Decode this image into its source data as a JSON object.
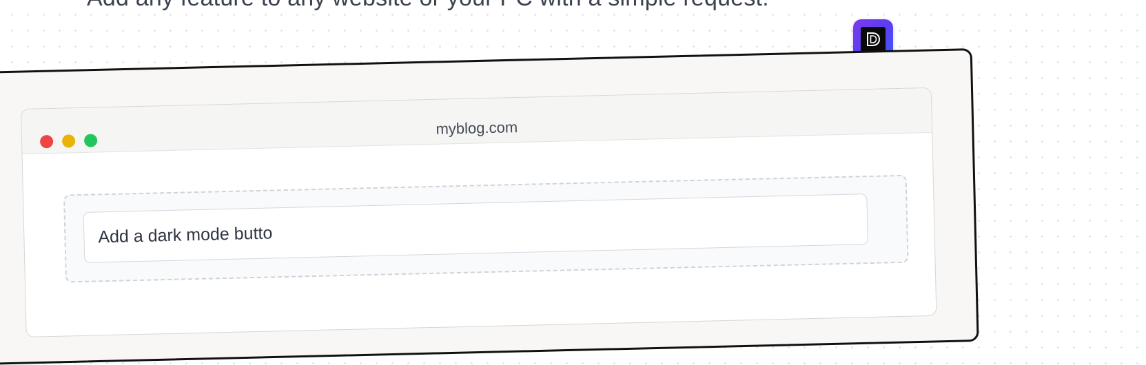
{
  "hero": {
    "headline": "Add any feature to any website or your PC with a simple request."
  },
  "app_icon": {
    "name": "app-logo-icon",
    "gradient": [
      "#7c3aed",
      "#3b5bf5"
    ]
  },
  "browser": {
    "url": "myblog.com",
    "traffic_lights": [
      {
        "name": "close",
        "color": "#ef4444"
      },
      {
        "name": "minimize",
        "color": "#eab308"
      },
      {
        "name": "maximize",
        "color": "#22c55e"
      }
    ]
  },
  "prompt": {
    "value": "Add a dark mode butto"
  }
}
